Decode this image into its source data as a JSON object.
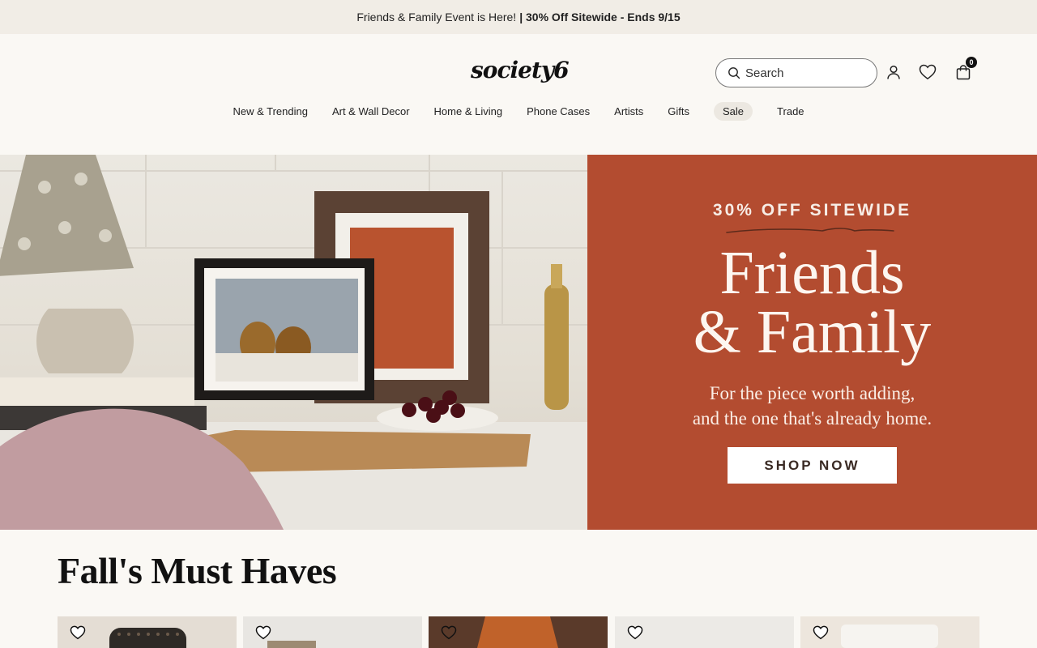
{
  "promo": {
    "text": "Friends & Family Event is Here!",
    "bold_text": "| 30% Off Sitewide - Ends 9/15"
  },
  "header": {
    "logo": "society6",
    "search_placeholder": "Search",
    "cart_count": "0"
  },
  "nav": {
    "items": [
      "New & Trending",
      "Art & Wall Decor",
      "Home & Living",
      "Phone Cases",
      "Artists",
      "Gifts",
      "Sale",
      "Trade"
    ]
  },
  "hero": {
    "eyebrow": "30% OFF SITEWIDE",
    "title_line1": "Friends",
    "title_line2": "& Family",
    "subtitle_line1": "For the piece worth adding,",
    "subtitle_line2": "and the one that's already home.",
    "cta": "SHOP NOW",
    "panel_color": "#b34c30"
  },
  "section": {
    "title": "Fall's Must Haves"
  },
  "icons": {
    "search": "search-icon",
    "account": "user-icon",
    "wishlist": "heart-icon",
    "cart": "shopping-bag-icon",
    "product_wishlist": "heart-outline-icon"
  }
}
